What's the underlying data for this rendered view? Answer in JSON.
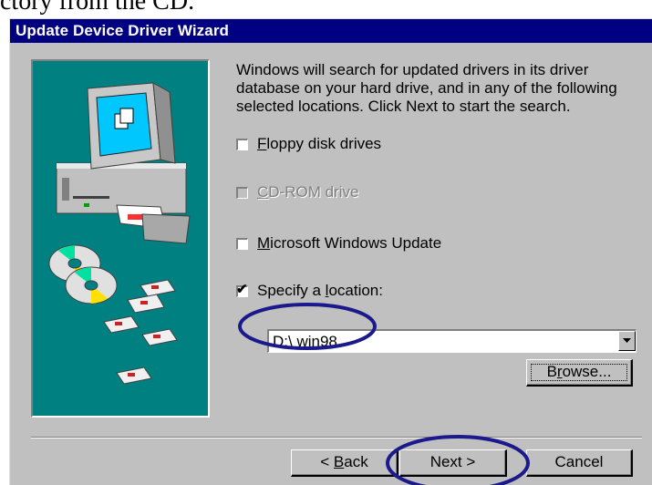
{
  "document": {
    "fragment_text": "ctory from the CD."
  },
  "window": {
    "title": "Update Device Driver Wizard"
  },
  "description": "Windows will search for updated drivers in its driver database on your hard drive, and in any of the following selected locations. Click Next to start the search.",
  "options": [
    {
      "mnemonic": "F",
      "rest": "loppy disk drives",
      "checked": false,
      "enabled": true
    },
    {
      "mnemonic": "C",
      "rest": "D-ROM drive",
      "checked": false,
      "enabled": false
    },
    {
      "mnemonic": "M",
      "rest": "icrosoft Windows Update",
      "checked": false,
      "enabled": true
    },
    {
      "before": "Specify a ",
      "mnemonic": "l",
      "rest": "ocation:",
      "checked": true,
      "enabled": true
    }
  ],
  "location": {
    "value": "D:\\ win98"
  },
  "buttons": {
    "browse": {
      "mnemonic": "r",
      "before": "B",
      "rest": "owse..."
    },
    "back": {
      "arrow": "< ",
      "mnemonic": "B",
      "rest": "ack"
    },
    "next": {
      "label": "Next >"
    },
    "cancel": {
      "label": "Cancel"
    }
  },
  "annotation_color": "#1a1a8c",
  "colors": {
    "titlebar": "#000080",
    "graphic_bg": "#008080",
    "face": "#c0c0c0"
  },
  "icons": [
    "computer-icon",
    "cd-icon",
    "floppy-icon",
    "checkmark-icon",
    "dropdown-arrow-icon"
  ]
}
